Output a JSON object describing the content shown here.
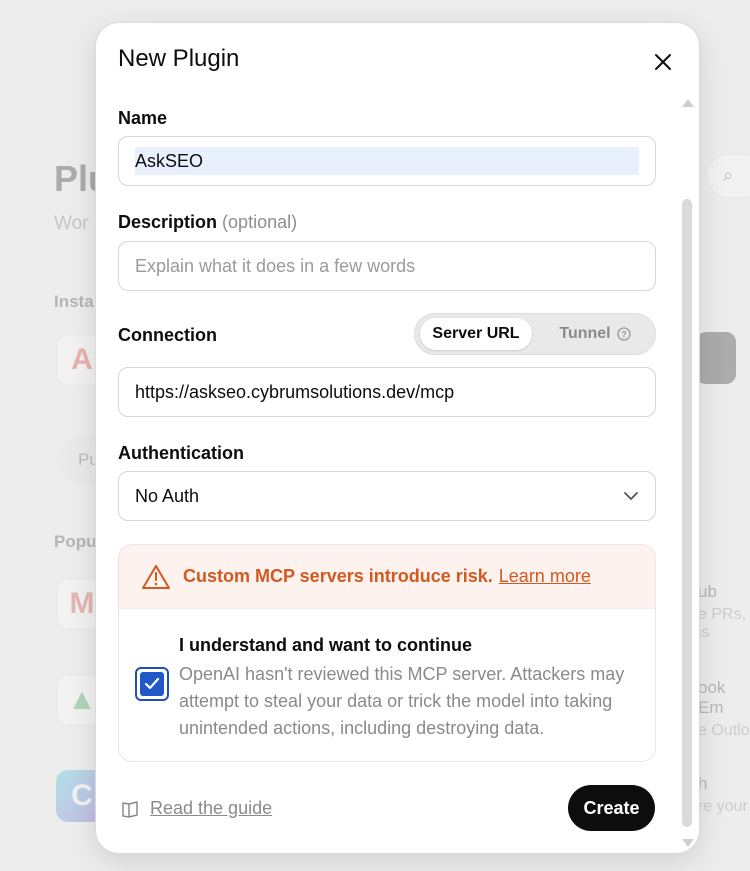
{
  "background": {
    "title": "Plu",
    "subtitle": "Wor",
    "installed_label": "Insta",
    "popular_label": "Popu",
    "pill_label": "Pu",
    "right_items": [
      {
        "title": "ub",
        "subtitle": "e PRs, is"
      },
      {
        "title": "ook Em",
        "subtitle": "e Outlo"
      },
      {
        "title": "h",
        "subtitle": "re your"
      }
    ]
  },
  "modal": {
    "title": "New Plugin",
    "name": {
      "label": "Name",
      "value": "AskSEO"
    },
    "description": {
      "label": "Description",
      "optional": "(optional)",
      "placeholder": "Explain what it does in a few words"
    },
    "connection": {
      "label": "Connection",
      "options": [
        "Server URL",
        "Tunnel"
      ],
      "selected": "Server URL",
      "url": "https://askseo.cybrumsolutions.dev/mcp"
    },
    "authentication": {
      "label": "Authentication",
      "selected": "No Auth"
    },
    "warning": {
      "text": "Custom MCP servers introduce risk.",
      "link": "Learn more",
      "ack_title": "I understand and want to continue",
      "ack_desc": "OpenAI hasn't reviewed this MCP server. Attackers may attempt to steal your data or trick the model into taking unintended actions, including destroying data.",
      "checked": true,
      "warning_color": "#d2591f"
    },
    "guide_link": "Read the guide",
    "create_label": "Create"
  }
}
